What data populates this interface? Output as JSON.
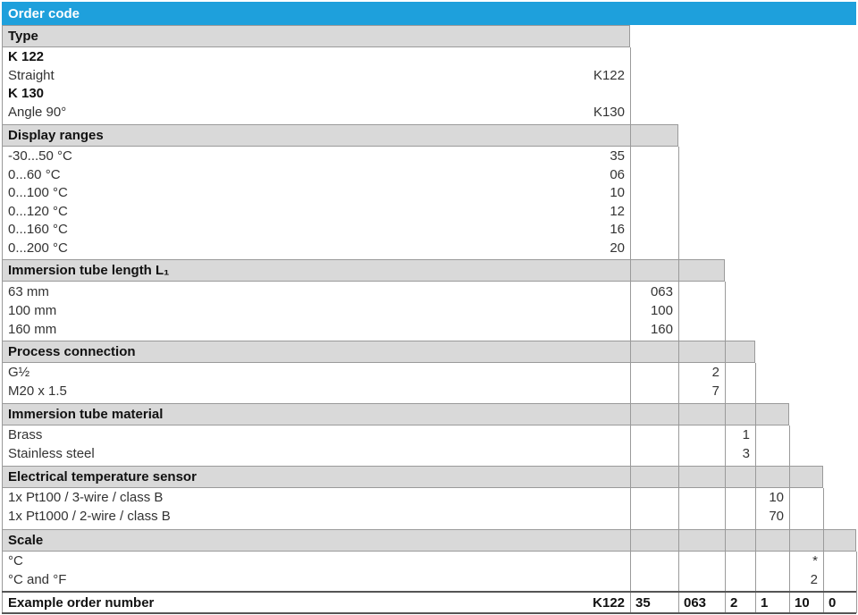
{
  "title": "Order code",
  "sections": [
    {
      "header": "Type",
      "rows": [
        {
          "label": "K 122",
          "bold": true,
          "code": ""
        },
        {
          "label": "Straight",
          "bold": false,
          "code": "K122"
        },
        {
          "label": "K 130",
          "bold": true,
          "code": ""
        },
        {
          "label": "Angle 90°",
          "bold": false,
          "code": "K130"
        }
      ]
    },
    {
      "header": "Display ranges",
      "rows": [
        {
          "label": "-30...50 °C",
          "code": "35"
        },
        {
          "label": "0...60 °C",
          "code": "06"
        },
        {
          "label": "0...100 °C",
          "code": "10"
        },
        {
          "label": "0...120 °C",
          "code": "12"
        },
        {
          "label": "0...160 °C",
          "code": "16"
        },
        {
          "label": "0...200 °C",
          "code": "20"
        }
      ]
    },
    {
      "header": "Immersion tube length L₁",
      "rows": [
        {
          "label": "63 mm",
          "code": "063"
        },
        {
          "label": "100 mm",
          "code": "100"
        },
        {
          "label": "160 mm",
          "code": "160"
        }
      ]
    },
    {
      "header": "Process connection",
      "rows": [
        {
          "label": "G½",
          "code": "2"
        },
        {
          "label": "M20 x 1.5",
          "code": "7"
        }
      ]
    },
    {
      "header": "Immersion tube material",
      "rows": [
        {
          "label": "Brass",
          "code": "1"
        },
        {
          "label": "Stainless steel",
          "code": "3"
        }
      ]
    },
    {
      "header": "Electrical temperature sensor",
      "rows": [
        {
          "label": "1x Pt100 / 3-wire / class B",
          "code": "10"
        },
        {
          "label": "1x Pt1000 / 2-wire / class B",
          "code": "70"
        }
      ]
    },
    {
      "header": "Scale",
      "rows": [
        {
          "label": "°C",
          "code": "*"
        },
        {
          "label": "°C and °F",
          "code": "2"
        }
      ]
    }
  ],
  "example": {
    "label": "Example order number",
    "codes": [
      "K122",
      "35",
      "063",
      "2",
      "1",
      "10",
      "0"
    ]
  },
  "colors": {
    "title_bar": "#1ea0dc",
    "header_bg": "#d9d9d9",
    "grid": "#9a9a9a"
  }
}
